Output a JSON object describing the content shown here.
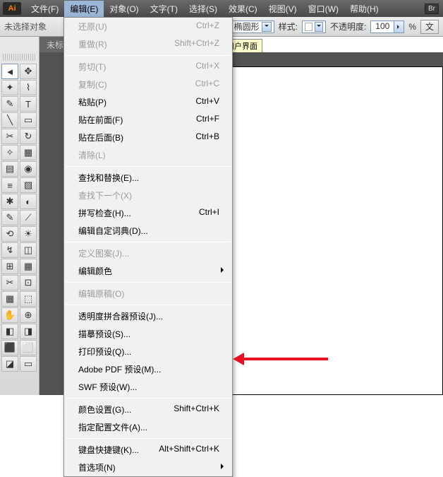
{
  "app_icon": "Ai",
  "menubar": {
    "file": "文件(F)",
    "edit": "编辑(E)",
    "object": "对象(O)",
    "type": "文字(T)",
    "select": "选择(S)",
    "effect": "效果(C)",
    "view": "视图(V)",
    "window": "窗口(W)",
    "help": "帮助(H)",
    "br": "Br"
  },
  "optbar": {
    "no_selection": "未选择对象",
    "shape_label": "椭圆形",
    "style_label": "样式:",
    "opacity_label": "不透明度:",
    "opacity_value": "100",
    "opacity_unit": "%",
    "doc_btn": "文"
  },
  "tab": {
    "title": "未标题"
  },
  "tooltip": "用户界面",
  "tools": {
    "t0": "◄",
    "t1": "✥",
    "t2": "✦",
    "t3": "⌇",
    "t4": "✎",
    "t5": "T",
    "t6": "╲",
    "t7": "▭",
    "t8": "✂",
    "t9": "↻",
    "t10": "✧",
    "t11": "▦",
    "t12": "▤",
    "t13": "◉",
    "t14": "≡",
    "t15": "▨",
    "t16": "✱",
    "t17": "◐",
    "t18": "✎",
    "t19": "⟋",
    "t20": "⟲",
    "t21": "☀",
    "t22": "↯",
    "t23": "◫",
    "t24": "⊞",
    "t25": "▦",
    "t26": "✂",
    "t27": "⊡",
    "t28": "▦",
    "t29": "⬚",
    "t30": "✋",
    "t31": "⊕",
    "t32": "◧",
    "t33": "◨",
    "t34": "⬛",
    "t35": "⬜",
    "t36": "◪",
    "t37": "▭"
  },
  "edit_menu": [
    {
      "label": "还原(U)",
      "shortcut": "Ctrl+Z",
      "disabled": true
    },
    {
      "label": "重做(R)",
      "shortcut": "Shift+Ctrl+Z",
      "disabled": true
    },
    {
      "sep": true
    },
    {
      "label": "剪切(T)",
      "shortcut": "Ctrl+X",
      "disabled": true
    },
    {
      "label": "复制(C)",
      "shortcut": "Ctrl+C",
      "disabled": true
    },
    {
      "label": "粘贴(P)",
      "shortcut": "Ctrl+V"
    },
    {
      "label": "贴在前面(F)",
      "shortcut": "Ctrl+F"
    },
    {
      "label": "贴在后面(B)",
      "shortcut": "Ctrl+B"
    },
    {
      "label": "清除(L)",
      "disabled": true
    },
    {
      "sep": true
    },
    {
      "label": "查找和替换(E)..."
    },
    {
      "label": "查找下一个(X)",
      "disabled": true
    },
    {
      "label": "拼写检查(H)...",
      "shortcut": "Ctrl+I"
    },
    {
      "label": "编辑自定词典(D)..."
    },
    {
      "sep": true
    },
    {
      "label": "定义图案(J)...",
      "disabled": true
    },
    {
      "label": "编辑颜色",
      "submenu": true
    },
    {
      "sep": true
    },
    {
      "label": "编辑原稿(O)",
      "disabled": true
    },
    {
      "sep": true
    },
    {
      "label": "透明度拼合器预设(J)..."
    },
    {
      "label": "描摹预设(S)..."
    },
    {
      "label": "打印预设(Q)..."
    },
    {
      "label": "Adobe PDF 预设(M)..."
    },
    {
      "label": "SWF 预设(W)..."
    },
    {
      "sep": true
    },
    {
      "label": "颜色设置(G)...",
      "shortcut": "Shift+Ctrl+K"
    },
    {
      "label": "指定配置文件(A)..."
    },
    {
      "sep": true
    },
    {
      "label": "键盘快捷键(K)...",
      "shortcut": "Alt+Shift+Ctrl+K"
    },
    {
      "label": "首选项(N)",
      "submenu": true
    }
  ]
}
